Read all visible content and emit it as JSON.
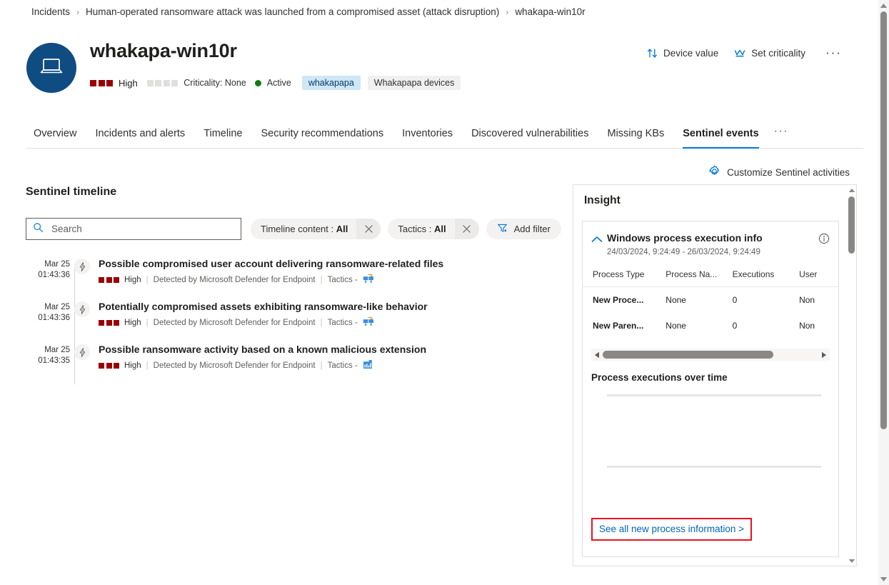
{
  "breadcrumb": {
    "items": [
      "Incidents",
      "Human-operated ransomware attack was launched from a compromised asset (attack disruption)",
      "whakapa-win10r"
    ],
    "separator": "›"
  },
  "header": {
    "avatar_icon": "laptop-icon",
    "title": "whakapa-win10r",
    "severity_label": "High",
    "severity_color": "#9b0000",
    "severity_blocks": 3,
    "criticality_text": "Criticality: None",
    "criticality_blocks": 4,
    "criticality_color": "#e1dfdd",
    "status_text": "Active",
    "status_color": "#107c10",
    "tag_primary": "whakapapa",
    "tag_secondary": "Whakapapa devices"
  },
  "commandbar": {
    "device_value": {
      "label": "Device value",
      "icon": "sort-arrows-icon"
    },
    "set_criticality": {
      "label": "Set criticality",
      "icon": "crown-icon"
    },
    "more": {
      "label": "···",
      "icon": "more-ellipsis-icon"
    }
  },
  "tabs": {
    "items": [
      {
        "label": "Overview",
        "active": false
      },
      {
        "label": "Incidents and alerts",
        "active": false
      },
      {
        "label": "Timeline",
        "active": false
      },
      {
        "label": "Security recommendations",
        "active": false
      },
      {
        "label": "Inventories",
        "active": false
      },
      {
        "label": "Discovered vulnerabilities",
        "active": false
      },
      {
        "label": "Missing KBs",
        "active": false
      },
      {
        "label": "Sentinel events",
        "active": true
      }
    ],
    "overflow": "···",
    "active_underline_color": "#0078d4"
  },
  "customize": {
    "label": "Customize Sentinel activities",
    "icon": "gear-icon"
  },
  "timeline_section": {
    "title": "Sentinel timeline",
    "search": {
      "placeholder": "Search",
      "value": "",
      "icon": "search-icon"
    },
    "filters": [
      {
        "label_prefix": "Timeline content : ",
        "label_value": "All",
        "clear_icon": "close-icon"
      },
      {
        "label_prefix": "Tactics : ",
        "label_value": "All",
        "clear_icon": "close-icon"
      }
    ],
    "add_filter": {
      "label": "Add filter",
      "icon": "filter-icon"
    },
    "events": [
      {
        "date": "Mar 25",
        "time": "01:43:36",
        "node_icon": "lightning-bolt-icon",
        "headline": "Possible compromised user account delivering ransomware-related files",
        "severity": "High",
        "source": "Detected by Microsoft Defender for Endpoint",
        "tactics_label": "Tactics -",
        "tactics_icon": "lateral-movement-icon"
      },
      {
        "date": "Mar 25",
        "time": "01:43:36",
        "node_icon": "lightning-bolt-icon",
        "headline": "Potentially compromised assets exhibiting ransomware-like behavior",
        "severity": "High",
        "source": "Detected by Microsoft Defender for Endpoint",
        "tactics_label": "Tactics -",
        "tactics_icon": "lateral-movement-icon"
      },
      {
        "date": "Mar 25",
        "time": "01:43:35",
        "node_icon": "lightning-bolt-icon",
        "headline": "Possible ransomware activity based on a known malicious extension",
        "severity": "High",
        "source": "Detected by Microsoft Defender for Endpoint",
        "tactics_label": "Tactics -",
        "tactics_icon": "impact-icon"
      }
    ]
  },
  "insight": {
    "title": "Insight",
    "card": {
      "collapse_icon": "chevron-up-icon",
      "title": "Windows process execution info",
      "time_range": "24/03/2024, 9:24:49 - 26/03/2024, 9:24:49",
      "info_icon": "info-icon",
      "table": {
        "columns": [
          "Process Type",
          "Process Na...",
          "Executions",
          "User"
        ],
        "rows": [
          [
            "New Proce...",
            "None",
            "0",
            "Non"
          ],
          [
            "New Paren...",
            "None",
            "0",
            "Non"
          ]
        ]
      },
      "hscrollbar": {
        "left_arrow": "caret-left-icon",
        "right_arrow": "caret-right-icon"
      },
      "chart_label": "Process executions over time",
      "see_all_link": "See all new process information >",
      "highlight_color": "#e81123"
    },
    "scrollbar": {
      "up_arrow": "caret-up-icon",
      "down_arrow": "caret-down-icon"
    }
  },
  "page_scrollbar": {
    "up_arrow": "caret-up-icon",
    "down_arrow": "caret-down-icon"
  },
  "chart_data": {
    "type": "line",
    "title": "Process executions over time",
    "x": [],
    "values": [],
    "xlabel": "",
    "ylabel": "",
    "grid": true,
    "note": "empty plot area with two horizontal gridlines, no data plotted"
  }
}
